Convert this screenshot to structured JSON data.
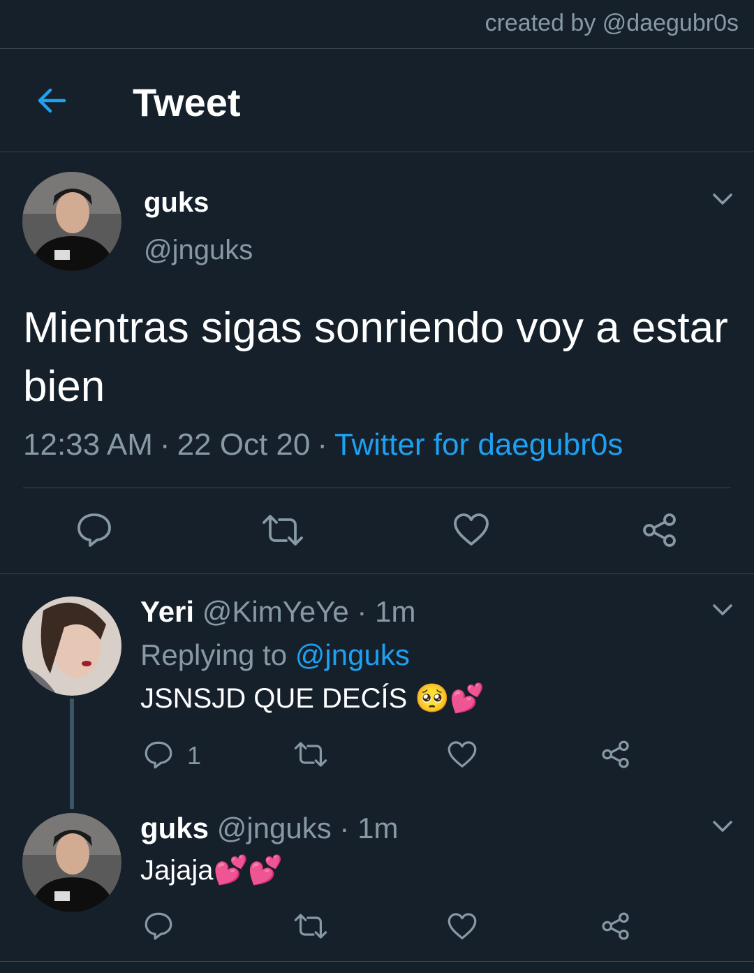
{
  "watermark": "created by @daegubr0s",
  "header": {
    "title": "Tweet"
  },
  "main_tweet": {
    "name": "guks",
    "handle": "@jnguks",
    "text": "Mientras sigas sonriendo voy a estar bien",
    "time": "12:33 AM",
    "date": "22 Oct 20",
    "separator": "·",
    "client": "Twitter for daegubr0s"
  },
  "replies": [
    {
      "name": "Yeri",
      "handle": "@KimYeYe",
      "time": "1m",
      "separator": "·",
      "replying_prefix": "Replying to",
      "replying_to": "@jnguks",
      "text": "JSNSJD QUE DECÍS 🥺💕",
      "reply_count": "1"
    },
    {
      "name": "guks",
      "handle": "@jnguks",
      "time": "1m",
      "separator": "·",
      "text": "Jajaja💕💕"
    }
  ],
  "icons": {
    "back": "arrow-left-icon",
    "more": "chevron-down-icon",
    "reply": "reply-bubble-icon",
    "retweet": "retweet-icon",
    "like": "heart-icon",
    "share": "share-icon"
  },
  "colors": {
    "background": "#15202b",
    "accent": "#1da1f2",
    "secondary_text": "#8899a6",
    "divider": "#38444d"
  }
}
